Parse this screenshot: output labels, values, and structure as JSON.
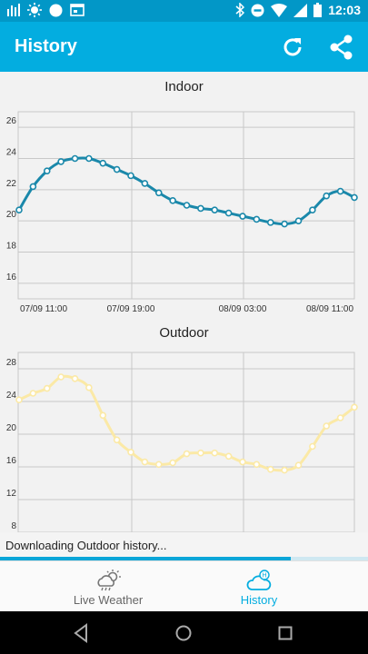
{
  "statusbar": {
    "time": "12:03"
  },
  "appbar": {
    "title": "History"
  },
  "colors": {
    "accent": "#03ade0",
    "indoor_line": "#1a88aa",
    "outdoor_line": "#fbe9a6",
    "grid": "#c8c8c8"
  },
  "indoor_title": "Indoor",
  "outdoor_title": "Outdoor",
  "toast": {
    "message": "Downloading Outdoor history..."
  },
  "progress": {
    "fraction": 0.79
  },
  "bottom_nav": {
    "live_label": "Live Weather",
    "history_label": "History",
    "history_badge": "H"
  },
  "chart_data": [
    {
      "type": "line",
      "title": "Indoor",
      "x_ticks": [
        "07/09 11:00",
        "07/09 19:00",
        "08/09 03:00",
        "08/09 11:00"
      ],
      "y_ticks": [
        16,
        18,
        20,
        22,
        24,
        26
      ],
      "ylim": [
        15,
        27
      ],
      "series": [
        {
          "values": [
            20.7,
            22.2,
            23.2,
            23.8,
            24.0,
            24.0,
            23.7,
            23.3,
            22.9,
            22.4,
            21.8,
            21.3,
            21.0,
            20.8,
            20.7,
            20.5,
            20.3,
            20.1,
            19.9,
            19.8,
            20.0,
            20.7,
            21.6,
            21.9,
            21.5
          ]
        }
      ],
      "grid": true
    },
    {
      "type": "line",
      "title": "Outdoor",
      "y_ticks": [
        8,
        12,
        16,
        20,
        24,
        28
      ],
      "ylim": [
        8,
        30
      ],
      "series": [
        {
          "values": [
            24.2,
            25.0,
            25.6,
            27.0,
            26.8,
            25.7,
            22.3,
            19.3,
            17.8,
            16.6,
            16.3,
            16.5,
            17.6,
            17.7,
            17.7,
            17.3,
            16.6,
            16.3,
            15.7,
            15.6,
            16.2,
            18.5,
            21.0,
            22.0,
            23.3
          ]
        }
      ],
      "grid": true
    }
  ]
}
